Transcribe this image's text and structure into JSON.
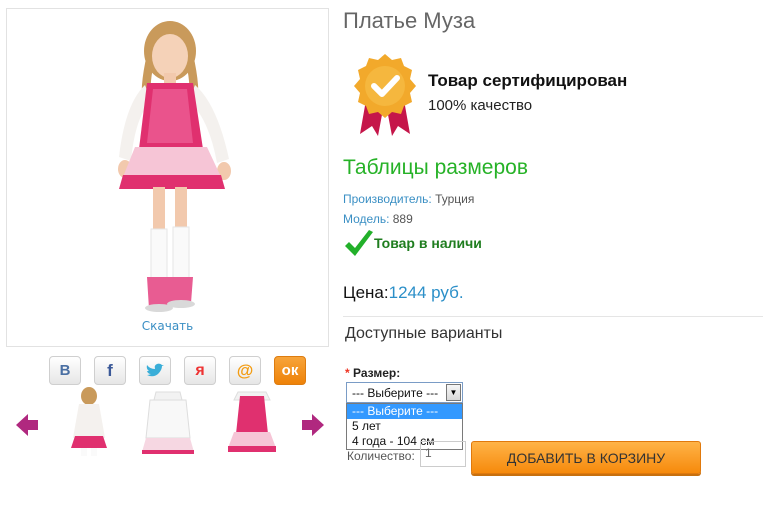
{
  "product": {
    "title": "Платье Муза",
    "download_label": "Скачать"
  },
  "certificate": {
    "title": "Товар сертифицирован",
    "subtitle": "100% качество",
    "badge_color": "#f2a92b",
    "ribbon_color": "#c5164a"
  },
  "size_table_link": "Таблицы размеров",
  "manufacturer": {
    "label": "Производитель:",
    "value": "Турция"
  },
  "model": {
    "label": "Модель:",
    "value": "889"
  },
  "stock_status": "Товар в наличи",
  "price": {
    "label": "Цена:",
    "value": "1244 руб."
  },
  "variants_heading": "Доступные варианты",
  "option": {
    "required_mark": "*",
    "label": "Размер:",
    "selected": "--- Выберите ---",
    "options": [
      "--- Выберите ---",
      "5 лет",
      "4 года - 104 см"
    ]
  },
  "quantity": {
    "label": "Количество:",
    "value": "1"
  },
  "add_to_cart_label": "ДОБАВИТЬ В КОРЗИНУ",
  "share_icons": [
    "vk-icon",
    "facebook-icon",
    "twitter-icon",
    "odnoklassniki-icon",
    "mail-icon",
    "ok-icon"
  ],
  "colors": {
    "accent_green": "#26b227",
    "link_blue": "#3a8fc4",
    "price_blue": "#2b8fc8",
    "cart_orange": "#f68a0c",
    "dress_pink": "#e0306f",
    "arrow_purple": "#b0287f"
  }
}
